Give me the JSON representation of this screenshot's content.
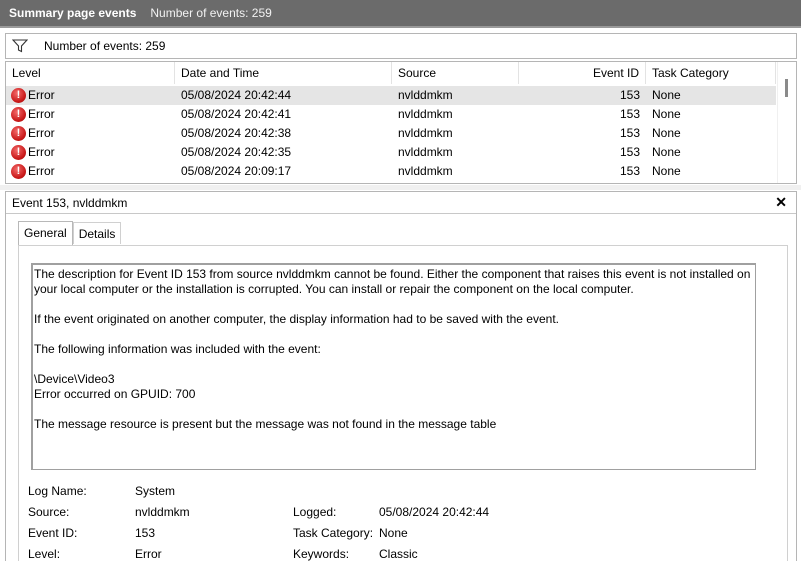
{
  "header": {
    "title": "Summary page events",
    "count_text": "Number of events: 259"
  },
  "filter": {
    "icon": "filter-icon",
    "text": "Number of events: 259"
  },
  "table": {
    "columns": [
      "Level",
      "Date and Time",
      "Source",
      "Event ID",
      "Task Category"
    ],
    "rows": [
      {
        "level": "Error",
        "date": "05/08/2024 20:42:44",
        "source": "nvlddmkm",
        "event_id": "153",
        "task": "None"
      },
      {
        "level": "Error",
        "date": "05/08/2024 20:42:41",
        "source": "nvlddmkm",
        "event_id": "153",
        "task": "None"
      },
      {
        "level": "Error",
        "date": "05/08/2024 20:42:38",
        "source": "nvlddmkm",
        "event_id": "153",
        "task": "None"
      },
      {
        "level": "Error",
        "date": "05/08/2024 20:42:35",
        "source": "nvlddmkm",
        "event_id": "153",
        "task": "None"
      },
      {
        "level": "Error",
        "date": "05/08/2024 20:09:17",
        "source": "nvlddmkm",
        "event_id": "153",
        "task": "None"
      }
    ]
  },
  "detail": {
    "title": "Event 153, nvlddmkm",
    "close": "✕",
    "tabs": [
      "General",
      "Details"
    ],
    "description": {
      "p1a": "The description for Event ID 153 from source nvlddmkm cannot be found. Either the component that raises this event is not installed on",
      "p1b": "your local computer or the installation is corrupted. You can install or repair the component on the local computer.",
      "p2": "If the event originated on another computer, the display information had to be saved with the event.",
      "p3": "The following information was included with the event:",
      "p4a": "\\Device\\Video3",
      "p4b": "Error occurred on GPUID: 700",
      "p5": "The message resource is present but the message was not found in the message table"
    },
    "props": {
      "log_name_label": "Log Name:",
      "log_name": "System",
      "source_label": "Source:",
      "source": "nvlddmkm",
      "logged_label": "Logged:",
      "logged": "05/08/2024 20:42:44",
      "event_id_label": "Event ID:",
      "event_id": "153",
      "task_category_label": "Task Category:",
      "task_category": "None",
      "level_label": "Level:",
      "level": "Error",
      "keywords_label": "Keywords:",
      "keywords": "Classic"
    }
  }
}
